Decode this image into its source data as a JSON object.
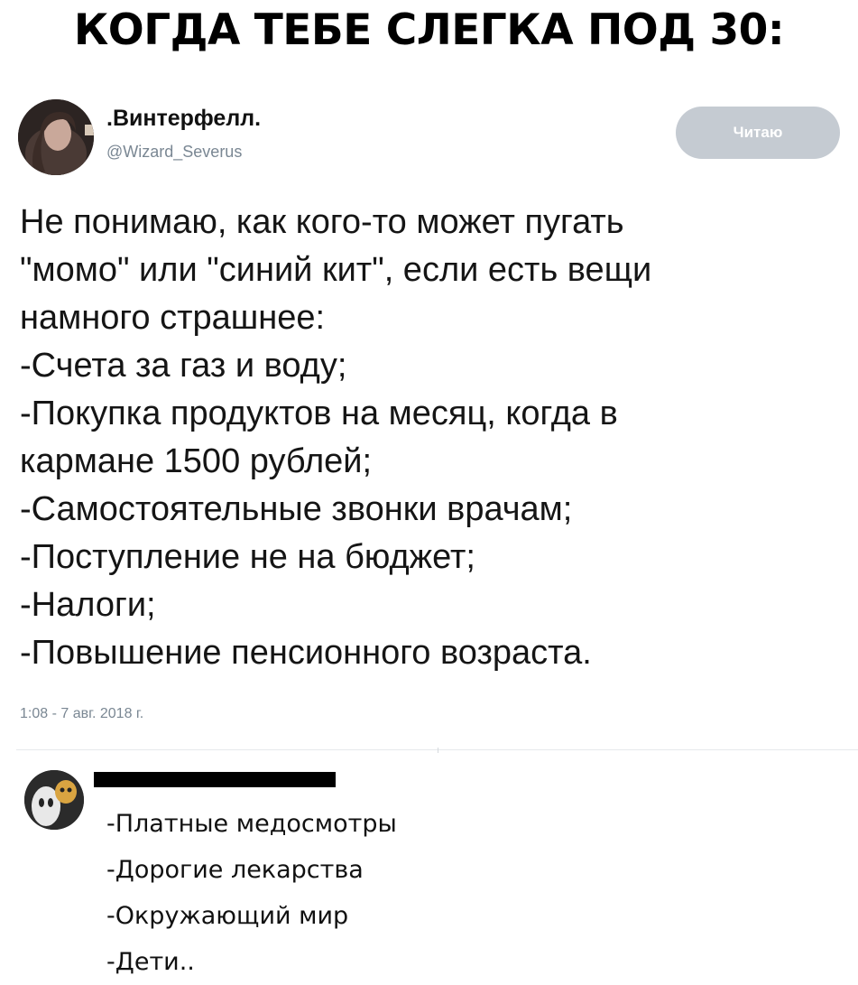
{
  "meme_title": "КОГДА ТЕБЕ СЛЕГКА ПОД 30:",
  "tweet": {
    "author_name": ".Винтерфелл.",
    "author_handle": "@Wizard_Severus",
    "follow_button_label": "Читаю",
    "text_lines": [
      "Не понимаю, как кого-то может пугать",
      "\"момо\" или \"синий кит\", если есть вещи",
      "намного страшнее:",
      "-Счета за газ и воду;",
      "-Покупка продуктов на месяц, когда в",
      "кармане 1500 рублей;",
      "-Самостоятельные звонки врачам;",
      "-Поступление не на бюджет;",
      "-Налоги;",
      "-Повышение пенсионного возраста."
    ],
    "timestamp": "1:08 - 7 авг. 2018 г."
  },
  "comment": {
    "lines": [
      "-Платные медосмотры",
      "-Дорогие лекарства",
      "-Окружающий мир",
      "-Дети.."
    ]
  },
  "colors": {
    "follow_button_bg": "#c5cbd2",
    "handle_gray": "#7a8793",
    "divider": "#e6e9ec"
  }
}
